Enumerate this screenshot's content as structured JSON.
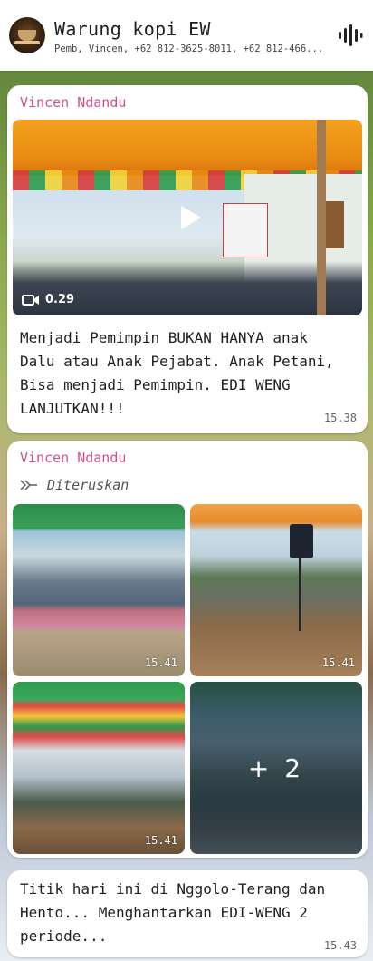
{
  "header": {
    "title": "Warung kopi EW",
    "members": "Pemb, Vincen, +62 812-3625-8011, +62 812-466...",
    "voice_icon": "audio-waveform-icon"
  },
  "messages": [
    {
      "sender": "Vincen Ndandu",
      "media": {
        "type": "video",
        "duration": "0.29",
        "icon": "play-icon"
      },
      "text": "Menjadi Pemimpin BUKAN HANYA anak Dalu atau Anak Pejabat. Anak Petani, Bisa menjadi Pemimpin. EDI WENG LANJUTKAN!!!",
      "time": "15.38"
    },
    {
      "sender": "Vincen Ndandu",
      "forwarded_label": "Diteruskan",
      "photos": [
        {
          "time": "15.41"
        },
        {
          "time": "15.41"
        },
        {
          "time": "15.41"
        },
        {
          "more": "+ 2"
        }
      ]
    },
    {
      "text": "Titik hari ini di Nggolo-Terang dan Hento... Menghantarkan EDI-WENG 2 periode...",
      "time": "15.43"
    }
  ]
}
